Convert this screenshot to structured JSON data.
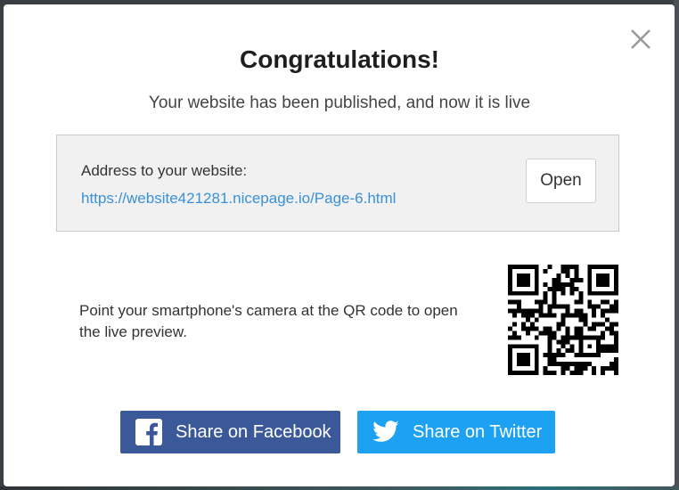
{
  "dialog": {
    "title": "Congratulations!",
    "subtitle": "Your website has been published, and now it is live",
    "close_icon": "close-icon"
  },
  "address": {
    "label": "Address to your website:",
    "url": "https://website421281.nicepage.io/Page-6.html",
    "open_label": "Open"
  },
  "qr": {
    "text": "Point your smartphone's camera at the QR code to open the live preview.",
    "icon": "qr-code"
  },
  "share": {
    "facebook_label": "Share on Facebook",
    "facebook_icon": "facebook-icon",
    "facebook_color": "#3b5998",
    "twitter_label": "Share on Twitter",
    "twitter_icon": "twitter-icon",
    "twitter_color": "#1da1f2"
  },
  "colors": {
    "link": "#3a91d8",
    "title": "#1e1e1e"
  }
}
